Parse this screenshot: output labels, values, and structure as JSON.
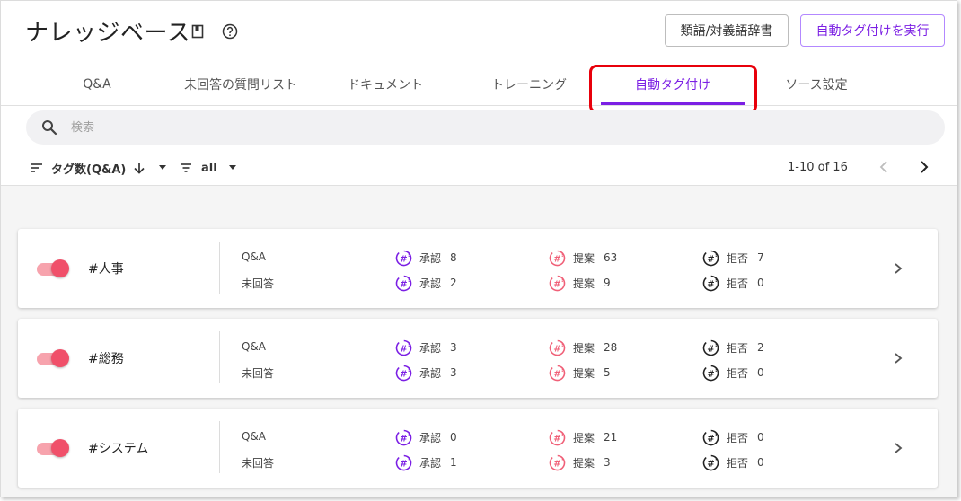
{
  "header": {
    "title": "ナレッジベース",
    "dict_button": "類語/対義語辞書",
    "run_button": "自動タグ付けを実行"
  },
  "tabs": [
    {
      "label": "Q&A"
    },
    {
      "label": "未回答の質問リスト"
    },
    {
      "label": "ドキュメント"
    },
    {
      "label": "トレーニング"
    },
    {
      "label": "自動タグ付け",
      "active": true
    },
    {
      "label": "ソース設定"
    }
  ],
  "search": {
    "placeholder": "検索",
    "value": ""
  },
  "toolbar": {
    "sort_label": "タグ数(Q&A)",
    "filter_label": "all",
    "pager": "1-10 of 16"
  },
  "colors": {
    "accent": "#7b1fe4",
    "approve": "#7b1fe4",
    "propose": "#f06078",
    "reject": "#222222",
    "toggle_on": "#f0506a",
    "highlight": "#e8000b"
  },
  "cards": [
    {
      "name": "#人事",
      "enabled": true,
      "rows": [
        {
          "label": "Q&A",
          "approve_label": "承認",
          "approve": "8",
          "propose_label": "提案",
          "propose": "63",
          "reject_label": "拒否",
          "reject": "7"
        },
        {
          "label": "未回答",
          "approve_label": "承認",
          "approve": "2",
          "propose_label": "提案",
          "propose": "9",
          "reject_label": "拒否",
          "reject": "0"
        }
      ]
    },
    {
      "name": "#総務",
      "enabled": true,
      "rows": [
        {
          "label": "Q&A",
          "approve_label": "承認",
          "approve": "3",
          "propose_label": "提案",
          "propose": "28",
          "reject_label": "拒否",
          "reject": "2"
        },
        {
          "label": "未回答",
          "approve_label": "承認",
          "approve": "3",
          "propose_label": "提案",
          "propose": "5",
          "reject_label": "拒否",
          "reject": "0"
        }
      ]
    },
    {
      "name": "#システム",
      "enabled": true,
      "rows": [
        {
          "label": "Q&A",
          "approve_label": "承認",
          "approve": "0",
          "propose_label": "提案",
          "propose": "21",
          "reject_label": "拒否",
          "reject": "0"
        },
        {
          "label": "未回答",
          "approve_label": "承認",
          "approve": "1",
          "propose_label": "提案",
          "propose": "3",
          "reject_label": "拒否",
          "reject": "0"
        }
      ]
    }
  ]
}
